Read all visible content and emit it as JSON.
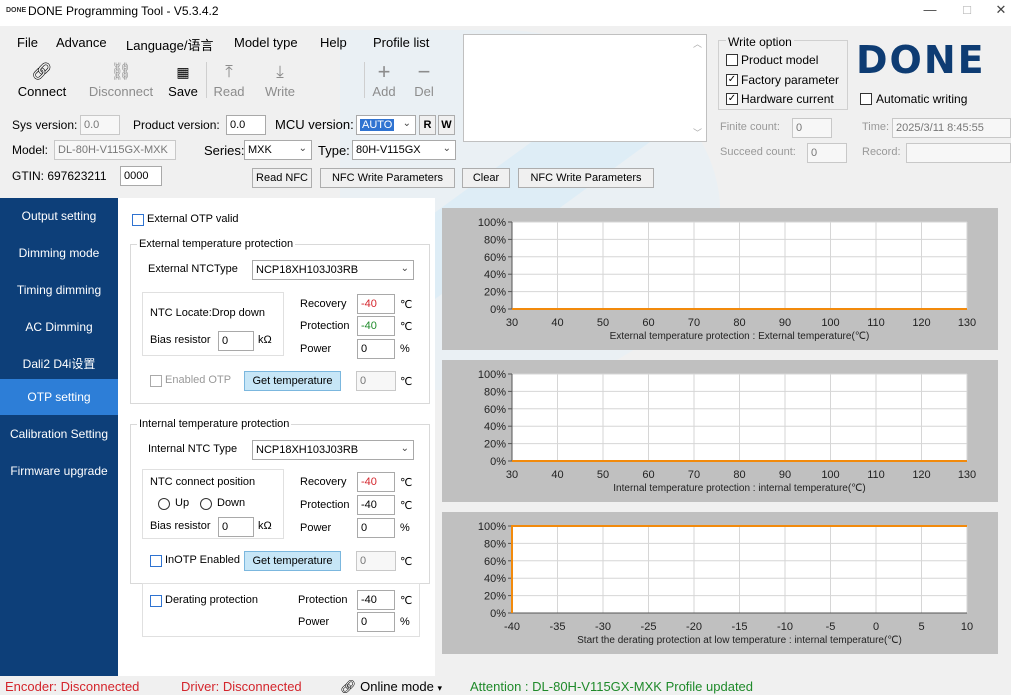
{
  "window": {
    "logo": "DONE",
    "title": "DONE Programming Tool - V5.3.4.2",
    "min": "—",
    "max": "□",
    "close": "✕"
  },
  "menu": [
    "File",
    "Advance",
    "Language/语言",
    "Model type",
    "Help",
    "Profile list"
  ],
  "toolbar": {
    "connect": "Connect",
    "disconnect": "Disconnect",
    "save": "Save",
    "read": "Read",
    "write": "Write",
    "add": "Add",
    "del": "Del"
  },
  "write_option": {
    "title": "Write option",
    "product_model": "Product model",
    "factory_parameter": "Factory parameter",
    "hardware_current": "Hardware current",
    "automatic_writing": "Automatic writing",
    "product_model_checked": false,
    "factory_parameter_checked": true,
    "hardware_current_checked": true,
    "automatic_writing_checked": false
  },
  "brand": "DONE",
  "counts": {
    "finite_label": "Finite count:",
    "finite_value": "0",
    "succeed_label": "Succeed count:",
    "succeed_value": "0",
    "time_label": "Time:",
    "time_value": "2025/3/11 8:45:55",
    "record_label": "Record:",
    "record_value": ""
  },
  "info": {
    "sys_version_label": "Sys version:",
    "sys_version": "0.0",
    "product_version_label": "Product version:",
    "product_version": "0.0",
    "mcu_version_label": "MCU version:",
    "mcu_version": "AUTO",
    "r": "R",
    "w": "W",
    "model_label": "Model:",
    "model": "DL-80H-V115GX-MXK",
    "series_label": "Series:",
    "series": "MXK",
    "type_label": "Type:",
    "type": "80H-V115GX",
    "gtin_label": "GTIN: 697623211",
    "gtin_suffix": "0000"
  },
  "nfc": {
    "read": "Read NFC",
    "write_params": "NFC Write Parameters",
    "clear": "Clear",
    "write_params2": "NFC Write Parameters"
  },
  "sidebar": [
    {
      "label": "Output setting",
      "active": false
    },
    {
      "label": "Dimming mode",
      "active": false
    },
    {
      "label": "Timing dimming",
      "active": false
    },
    {
      "label": "AC Dimming",
      "active": false
    },
    {
      "label": "Dali2 D4i设置",
      "active": false
    },
    {
      "label": "OTP setting",
      "active": true
    },
    {
      "label": "Calibration Setting",
      "active": false
    },
    {
      "label": "Firmware upgrade",
      "active": false
    }
  ],
  "ext": {
    "valid_label": "External OTP valid",
    "group_title": "External temperature  protection",
    "ntc_type_label": "External NTCType",
    "ntc_type": "NCP18XH103J03RB",
    "ntc_locate": "NTC Locate:Drop down",
    "bias_label": "Bias resistor",
    "bias_value": "0",
    "kohm": "kΩ",
    "recovery_label": "Recovery",
    "recovery_value": "-40",
    "protection_label": "Protection",
    "protection_value": "-40",
    "power_label": "Power",
    "power_value": "0",
    "deg": "℃",
    "pct": "%",
    "enabled_label": "Enabled OTP",
    "get_temp": "Get temperature",
    "temp_value": "0"
  },
  "int": {
    "group_title": "Internal temperature protection",
    "ntc_type_label": "Internal NTC Type",
    "ntc_type": "NCP18XH103J03RB",
    "connect_label": "NTC connect position",
    "up": "Up",
    "down": "Down",
    "bias_label": "Bias resistor",
    "bias_value": "0",
    "kohm": "kΩ",
    "recovery_label": "Recovery",
    "recovery_value": "-40",
    "protection_label": "Protection",
    "protection_value": "-40",
    "power_label": "Power",
    "power_value": "0",
    "deg": "℃",
    "pct": "%",
    "enabled_label": "InOTP Enabled",
    "get_temp": "Get temperature",
    "temp_value": "0"
  },
  "derating": {
    "label": "Derating protection",
    "protection_label": "Protection",
    "protection_value": "-40",
    "power_label": "Power",
    "power_value": "0",
    "deg": "℃",
    "pct": "%"
  },
  "colors": {
    "sidebar_bg": "#0d3f79",
    "sidebar_active": "#2d7ed7",
    "series_line": "#f28a0c",
    "recovery_red": "#d4252c",
    "protection_green": "#1f8a2a",
    "brand": "#0e3c73"
  },
  "chart_data": [
    {
      "type": "line",
      "xlabel": "External temperature protection : External temperature(℃)",
      "ylabel": "",
      "x_ticks": [
        30,
        40,
        50,
        60,
        70,
        80,
        90,
        100,
        110,
        120,
        130
      ],
      "y_ticks": [
        "0%",
        "20%",
        "40%",
        "60%",
        "80%",
        "100%"
      ],
      "xlim": [
        30,
        130
      ],
      "ylim": [
        0,
        100
      ],
      "grid": true,
      "series": [
        {
          "x": [
            30,
            130
          ],
          "y": [
            0,
            0
          ]
        }
      ]
    },
    {
      "type": "line",
      "xlabel": "Internal temperature protection : internal temperature(℃)",
      "ylabel": "",
      "x_ticks": [
        30,
        40,
        50,
        60,
        70,
        80,
        90,
        100,
        110,
        120,
        130
      ],
      "y_ticks": [
        "0%",
        "20%",
        "40%",
        "60%",
        "80%",
        "100%"
      ],
      "xlim": [
        30,
        130
      ],
      "ylim": [
        0,
        100
      ],
      "grid": true,
      "series": [
        {
          "x": [
            30,
            130
          ],
          "y": [
            0,
            0
          ]
        }
      ]
    },
    {
      "type": "line",
      "xlabel": "Start the derating protection at low temperature : internal temperature(℃)",
      "ylabel": "",
      "x_ticks": [
        -40,
        -35,
        -30,
        -25,
        -20,
        -15,
        -10,
        -5,
        0,
        5,
        10
      ],
      "y_ticks": [
        "0%",
        "20%",
        "40%",
        "60%",
        "80%",
        "100%"
      ],
      "xlim": [
        -40,
        10
      ],
      "ylim": [
        0,
        100
      ],
      "grid": true,
      "series": [
        {
          "x": [
            -40,
            -40,
            10
          ],
          "y": [
            0,
            100,
            100
          ]
        }
      ]
    }
  ],
  "status": {
    "encoder": "Encoder: Disconnected",
    "driver": "Driver: Disconnected",
    "mode": "Online mode",
    "attention": "Attention : DL-80H-V115GX-MXK Profile updated"
  }
}
